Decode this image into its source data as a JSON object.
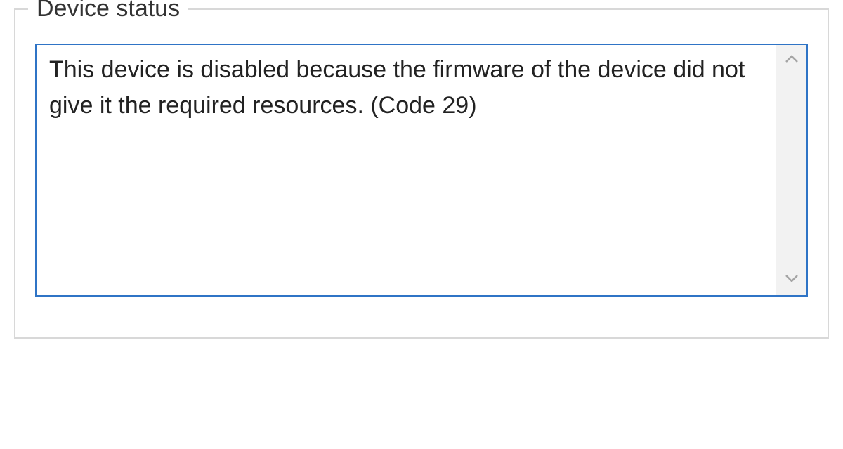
{
  "group": {
    "title": "Device status"
  },
  "status": {
    "message": "This device is disabled because the firmware of the device did not give it the required resources. (Code 29)"
  },
  "colors": {
    "border_focus": "#2f74c6",
    "group_border": "#d8d8d8",
    "scrollbar_bg": "#f2f2f2",
    "arrow_gray": "#a5a5a5"
  }
}
